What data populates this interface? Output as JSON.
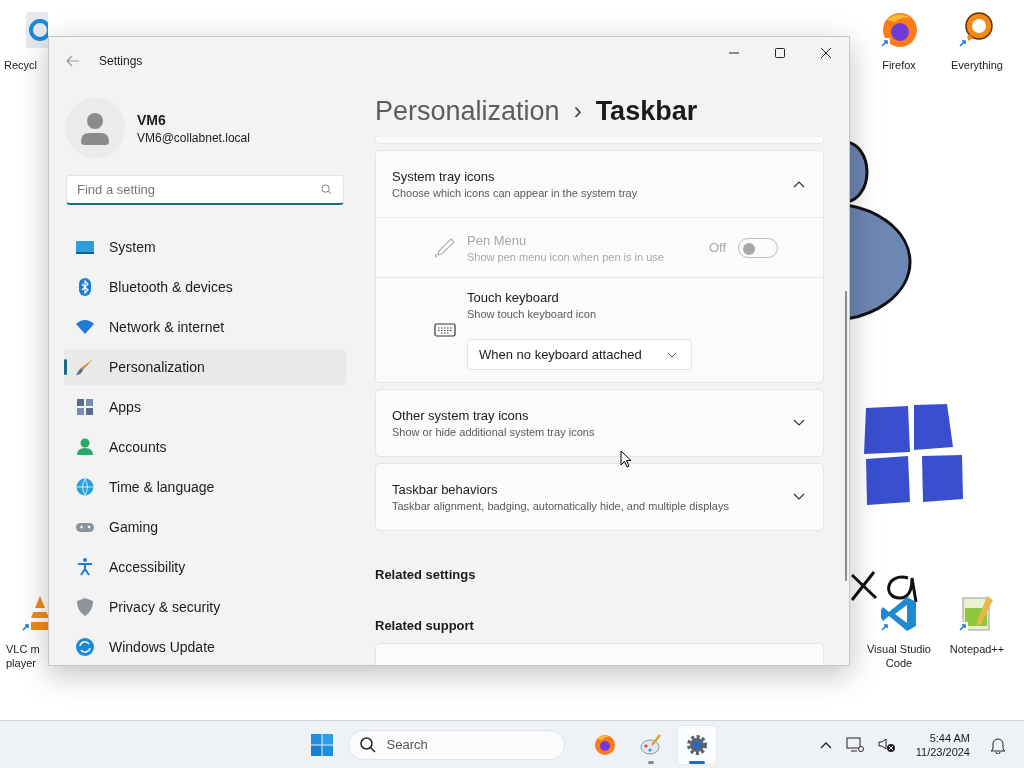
{
  "desktop_icons": [
    {
      "kind": "recycle",
      "label": [
        "Recycl"
      ]
    },
    {
      "kind": "firefox",
      "label": [
        "Firefox"
      ]
    },
    {
      "kind": "everything",
      "label": [
        "Everything"
      ]
    },
    {
      "kind": "vlc",
      "label": [
        "VLC m",
        "player"
      ]
    },
    {
      "kind": "vscode",
      "label": [
        "Visual Studio",
        "Code"
      ]
    },
    {
      "kind": "notepad",
      "label": [
        "Notepad++"
      ]
    }
  ],
  "window": {
    "title": "Settings"
  },
  "account": {
    "name": "VM6",
    "email": "VM6@collabnet.local"
  },
  "search": {
    "placeholder": "Find a setting"
  },
  "nav": [
    {
      "kind": "system",
      "label": "System",
      "selected": false
    },
    {
      "kind": "bluetooth",
      "label": "Bluetooth & devices",
      "selected": false
    },
    {
      "kind": "network",
      "label": "Network & internet",
      "selected": false
    },
    {
      "kind": "personalization",
      "label": "Personalization",
      "selected": true
    },
    {
      "kind": "apps",
      "label": "Apps",
      "selected": false
    },
    {
      "kind": "accounts",
      "label": "Accounts",
      "selected": false
    },
    {
      "kind": "time",
      "label": "Time & language",
      "selected": false
    },
    {
      "kind": "gaming",
      "label": "Gaming",
      "selected": false
    },
    {
      "kind": "accessibility",
      "label": "Accessibility",
      "selected": false
    },
    {
      "kind": "privacy",
      "label": "Privacy & security",
      "selected": false
    },
    {
      "kind": "update",
      "label": "Windows Update",
      "selected": false
    }
  ],
  "breadcrumb": {
    "parent": "Personalization",
    "separator": "›",
    "current": "Taskbar"
  },
  "sections": [
    {
      "title": "System tray icons",
      "subtitle": "Choose which icons can appear in the system tray",
      "expanded": true,
      "items": [
        {
          "kind": "toggle",
          "title": "Pen Menu",
          "subtitle": "Show pen menu icon when pen is in use",
          "disabled": true,
          "on": false,
          "state_label": "Off"
        },
        {
          "kind": "dropdown",
          "title": "Touch keyboard",
          "subtitle": "Show touch keyboard icon",
          "disabled": false,
          "value": "When no keyboard attached"
        }
      ]
    },
    {
      "title": "Other system tray icons",
      "subtitle": "Show or hide additional system tray icons",
      "expanded": false
    },
    {
      "title": "Taskbar behaviors",
      "subtitle": "Taskbar alignment, badging, automatically hide, and multiple displays",
      "expanded": false
    }
  ],
  "related": [
    {
      "title": "Related settings"
    },
    {
      "title": "Related support"
    }
  ],
  "taskbar": {
    "search_placeholder": "Search",
    "apps": [
      {
        "kind": "firefox",
        "running": false,
        "active": false
      },
      {
        "kind": "paint",
        "running": true,
        "active": false
      },
      {
        "kind": "settings",
        "running": true,
        "active": true
      }
    ],
    "time": "5:44 AM",
    "date": "11/23/2024"
  }
}
